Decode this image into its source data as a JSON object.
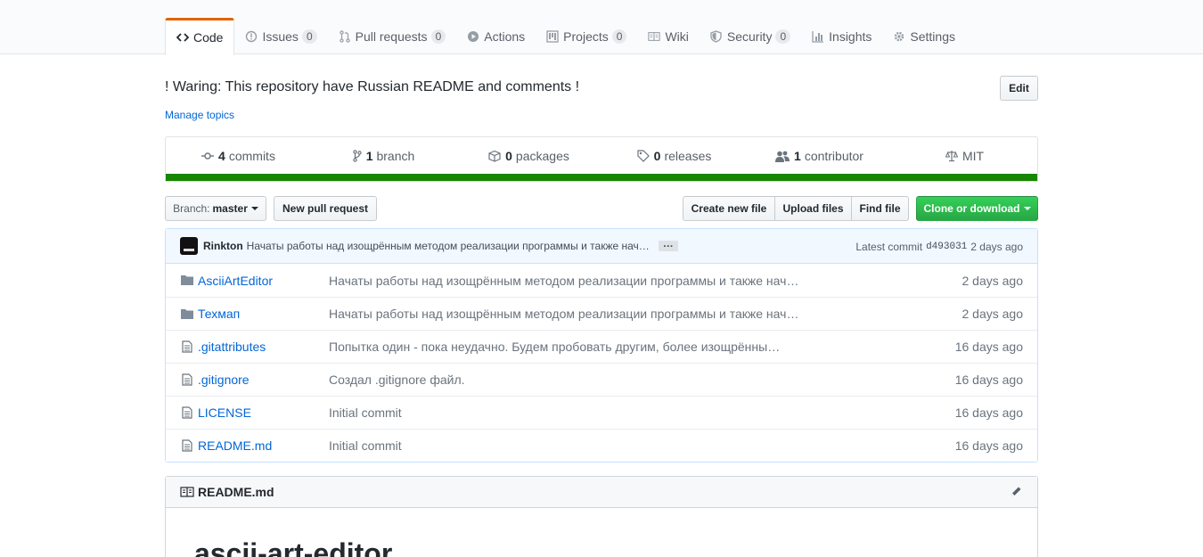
{
  "tabs": [
    {
      "label": "Code",
      "icon": "code-icon"
    },
    {
      "label": "Issues",
      "icon": "issue-icon",
      "count": "0"
    },
    {
      "label": "Pull requests",
      "icon": "pull-request-icon",
      "count": "0"
    },
    {
      "label": "Actions",
      "icon": "play-icon"
    },
    {
      "label": "Projects",
      "icon": "project-icon",
      "count": "0"
    },
    {
      "label": "Wiki",
      "icon": "book-icon"
    },
    {
      "label": "Security",
      "icon": "shield-icon",
      "count": "0"
    },
    {
      "label": "Insights",
      "icon": "graph-icon"
    },
    {
      "label": "Settings",
      "icon": "gear-icon"
    }
  ],
  "repo": {
    "description": "! Waring: This repository have Russian README and comments !",
    "manage_topics": "Manage topics",
    "edit_label": "Edit"
  },
  "summary": {
    "commits": {
      "num": "4",
      "label": "commits"
    },
    "branches": {
      "num": "1",
      "label": "branch"
    },
    "packages": {
      "num": "0",
      "label": "packages"
    },
    "releases": {
      "num": "0",
      "label": "releases"
    },
    "contributors": {
      "num": "1",
      "label": "contributor"
    },
    "license": "MIT",
    "language_color": "#178600"
  },
  "filenav": {
    "branch_prefix": "Branch:",
    "branch_name": "master",
    "new_pr": "New pull request",
    "create_file": "Create new file",
    "upload_files": "Upload files",
    "find_file": "Find file",
    "clone": "Clone or download"
  },
  "latest_commit": {
    "author": "Rinkton",
    "message": "Начаты работы над изощрённым методом реализации программы и также нач…",
    "ellipsis": "…",
    "prefix": "Latest commit",
    "sha": "d493031",
    "age": "2 days ago"
  },
  "files": [
    {
      "type": "dir",
      "name": "AsciiArtEditor",
      "message": "Начаты работы над изощрённым методом реализации программы и также нач…",
      "age": "2 days ago"
    },
    {
      "type": "dir",
      "name": "Техмап",
      "message": "Начаты работы над изощрённым методом реализации программы и также нач…",
      "age": "2 days ago"
    },
    {
      "type": "file",
      "name": ".gitattributes",
      "message": "Попытка один - пока неудачно. Будем пробовать другим, более изощрённы…",
      "age": "16 days ago"
    },
    {
      "type": "file",
      "name": ".gitignore",
      "message": "Создал .gitignore файл.",
      "age": "16 days ago"
    },
    {
      "type": "file",
      "name": "LICENSE",
      "message": "Initial commit",
      "age": "16 days ago"
    },
    {
      "type": "file",
      "name": "README.md",
      "message": "Initial commit",
      "age": "16 days ago"
    }
  ],
  "readme": {
    "filename": "README.md",
    "heading": "ascii-art-editor"
  }
}
